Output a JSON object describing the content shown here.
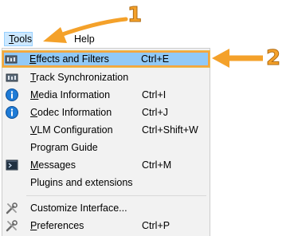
{
  "menubar": {
    "tools_label": "Tools",
    "help_label": "Help"
  },
  "menu": {
    "items": [
      {
        "label": "Effects and Filters",
        "shortcut": "Ctrl+E",
        "icon": "equalizer-icon",
        "highlighted": true
      },
      {
        "label": "Track Synchronization",
        "shortcut": "",
        "icon": "equalizer-icon"
      },
      {
        "label": "Media Information",
        "shortcut": "Ctrl+I",
        "icon": "info-icon"
      },
      {
        "label": "Codec Information",
        "shortcut": "Ctrl+J",
        "icon": "info-icon"
      },
      {
        "label": "VLM Configuration",
        "shortcut": "Ctrl+Shift+W",
        "icon": ""
      },
      {
        "label": "Program Guide",
        "shortcut": "",
        "icon": ""
      },
      {
        "label": "Messages",
        "shortcut": "Ctrl+M",
        "icon": "terminal-icon"
      },
      {
        "label": "Plugins and extensions",
        "shortcut": "",
        "icon": ""
      },
      {
        "label": "Customize Interface...",
        "shortcut": "",
        "icon": "tools-icon"
      },
      {
        "label": "Preferences",
        "shortcut": "Ctrl+P",
        "icon": "tools-icon"
      }
    ]
  },
  "callouts": {
    "one": "1",
    "two": "2"
  },
  "colors": {
    "highlight": "#91c9f7",
    "callout": "#f4a12a",
    "info_blue": "#1f7bd6"
  }
}
